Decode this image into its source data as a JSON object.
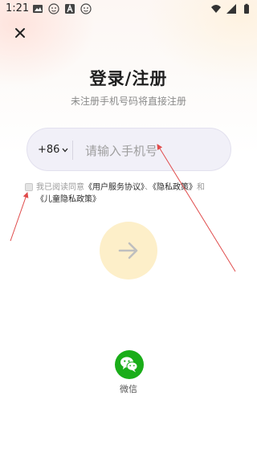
{
  "status_bar": {
    "time": "1:21"
  },
  "header": {
    "title": "登录/注册",
    "subtitle": "未注册手机号码将直接注册"
  },
  "phone": {
    "country_code": "+86",
    "placeholder": "请输入手机号",
    "value": ""
  },
  "agreement": {
    "checked": false,
    "prefix": "我已阅读同意",
    "user_agreement": "《用户服务协议》",
    "separator": "、",
    "privacy_policy": "《隐私政策》",
    "conjunction": "和",
    "children_privacy": "《儿童隐私政策》"
  },
  "social": {
    "wechat_label": "微信"
  },
  "colors": {
    "accent_button": "#fdefc9",
    "wechat_green": "#1aad19",
    "annotation_red": "#e04b4b"
  }
}
